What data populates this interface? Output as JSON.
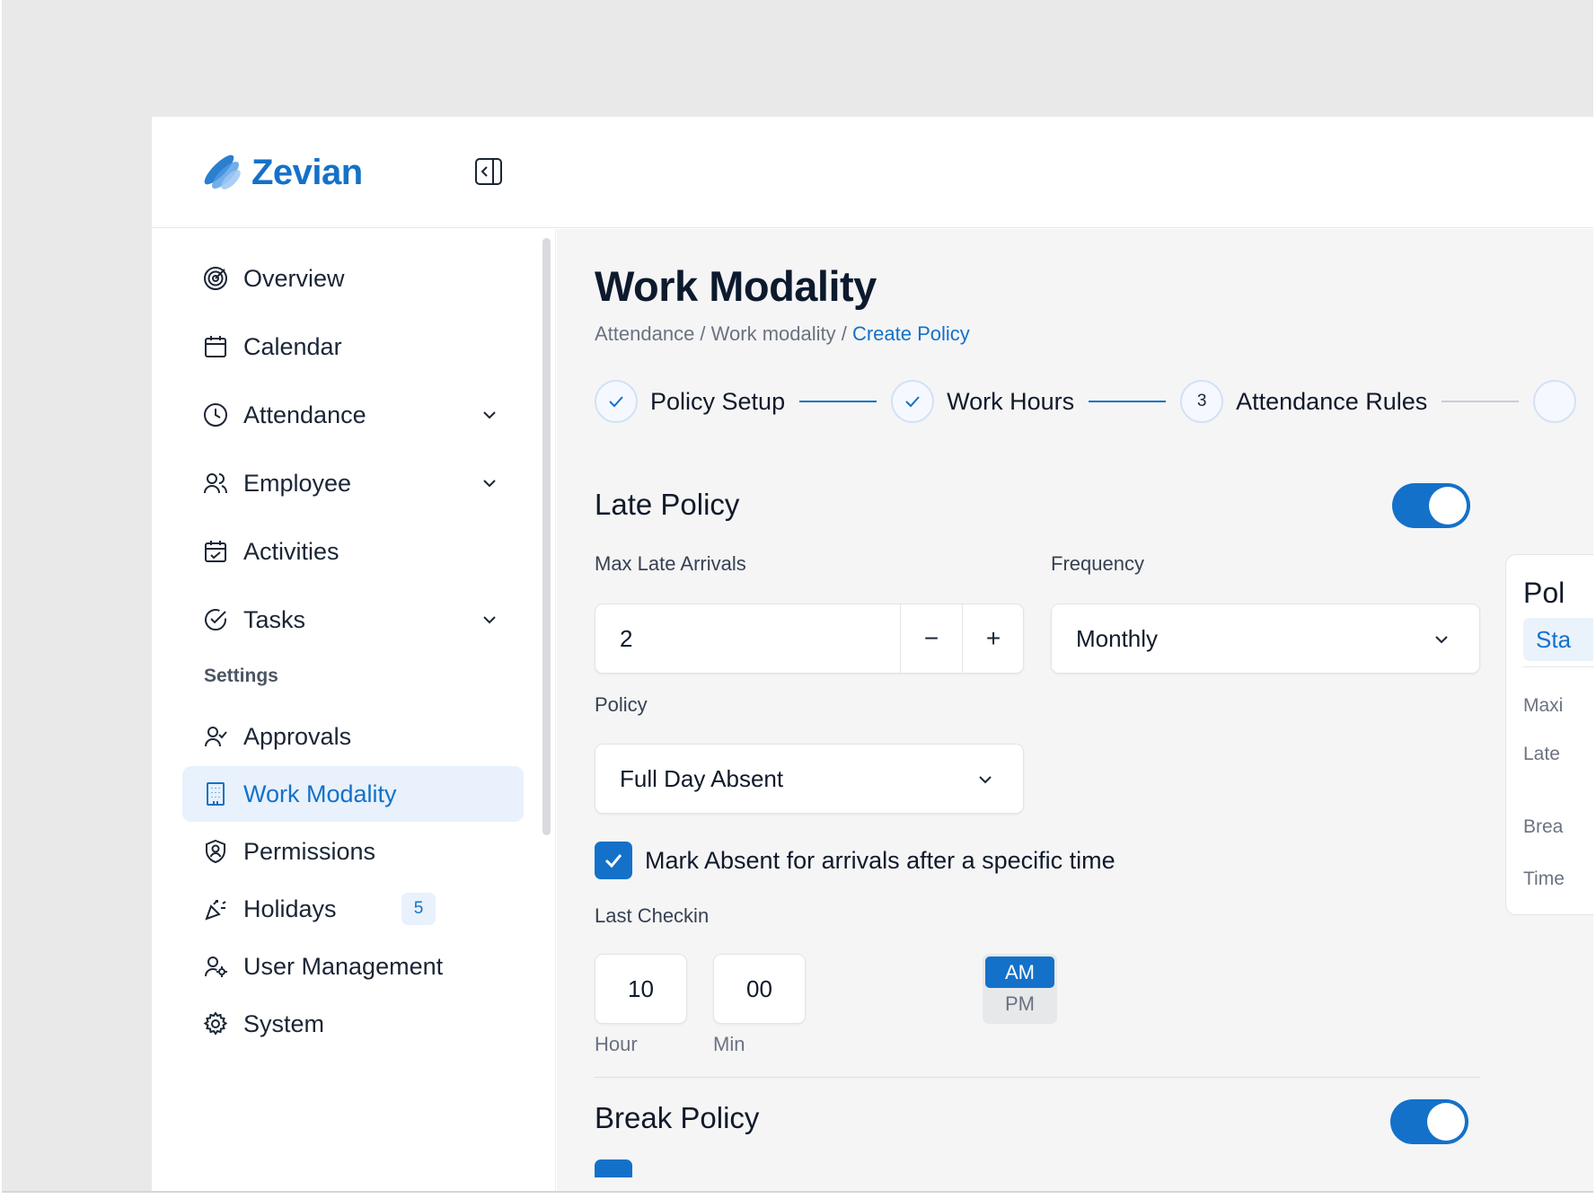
{
  "brand": {
    "name": "Zevian",
    "accent": "#1471c9"
  },
  "sidebar": {
    "items": [
      {
        "label": "Overview",
        "icon": "radar-icon",
        "has_chevron": false
      },
      {
        "label": "Calendar",
        "icon": "calendar-icon",
        "has_chevron": false
      },
      {
        "label": "Attendance",
        "icon": "clock-icon",
        "has_chevron": true
      },
      {
        "label": "Employee",
        "icon": "users-icon",
        "has_chevron": true
      },
      {
        "label": "Activities",
        "icon": "calendar-check-icon",
        "has_chevron": false
      },
      {
        "label": "Tasks",
        "icon": "check-circle-icon",
        "has_chevron": true
      }
    ],
    "settings_label": "Settings",
    "settings_items": [
      {
        "label": "Approvals",
        "icon": "user-check-icon"
      },
      {
        "label": "Work Modality",
        "icon": "building-icon",
        "active": true
      },
      {
        "label": "Permissions",
        "icon": "shield-user-icon"
      },
      {
        "label": "Holidays",
        "icon": "party-popper-icon",
        "badge": "5"
      },
      {
        "label": "User Management",
        "icon": "user-cog-icon"
      },
      {
        "label": "System",
        "icon": "gear-icon"
      }
    ]
  },
  "main": {
    "title": "Work Modality",
    "breadcrumb": {
      "part1": "Attendance",
      "sep": " / ",
      "part2": "Work modality",
      "current": "Create Policy"
    },
    "steps": [
      {
        "label": "Policy Setup",
        "state": "done"
      },
      {
        "label": "Work Hours",
        "state": "done"
      },
      {
        "label": "Attendance Rules",
        "state": "current",
        "number": "3"
      }
    ],
    "late_policy": {
      "title": "Late Policy",
      "enabled": true,
      "max_late_label": "Max Late Arrivals",
      "max_late_value": "2",
      "decrement": "−",
      "increment": "+",
      "frequency_label": "Frequency",
      "frequency_value": "Monthly",
      "policy_label": "Policy",
      "policy_value": "Full Day Absent",
      "checkbox_label": "Mark Absent for arrivals after a specific time",
      "checkbox_checked": true,
      "last_checkin_label": "Last Checkin",
      "hour": "10",
      "minute": "00",
      "am": "AM",
      "pm": "PM",
      "selected_period": "AM",
      "hour_label": "Hour",
      "min_label": "Min"
    },
    "break_policy": {
      "title": "Break Policy",
      "enabled": true
    }
  },
  "summary_card": {
    "title": "Pol",
    "tab": "Sta",
    "rows": [
      "Maxi",
      "Late",
      "Brea",
      "Time"
    ]
  }
}
